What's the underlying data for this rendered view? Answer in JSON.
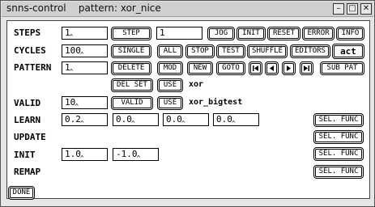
{
  "window": {
    "title": "snns-control    pattern: xor_nice",
    "controls": [
      "–",
      "□",
      "✕"
    ]
  },
  "rows": {
    "steps": {
      "label": "STEPS",
      "value": "1",
      "step_button": "STEP",
      "step_count": "1",
      "buttons": [
        "JOG",
        "INIT",
        "RESET",
        "ERROR",
        "INFO"
      ]
    },
    "cycles": {
      "label": "CYCLES",
      "value": "100",
      "buttons": [
        "SINGLE",
        "ALL",
        "STOP",
        "TEST",
        "SHUFFLE",
        "EDITORS"
      ],
      "act_label": "act"
    },
    "pattern": {
      "label": "PATTERN",
      "value": "1",
      "buttons": [
        "DELETE",
        "MOD",
        "NEW",
        "GOTO"
      ],
      "nav_icons": [
        "first-icon",
        "prev-icon",
        "next-icon",
        "last-icon"
      ],
      "sub_pat": "SUB PAT"
    },
    "set": {
      "del_set": "DEL SET",
      "use": "USE",
      "set_name": "xor"
    },
    "valid": {
      "label": "VALID",
      "value": "10",
      "valid_button": "VALID",
      "use": "USE",
      "set_name": "xor_bigtest"
    },
    "learn": {
      "label": "LEARN",
      "params": [
        "0.2",
        "0.0",
        "0.0",
        "0.0"
      ],
      "func_button": "SEL. FUNC"
    },
    "update": {
      "label": "UPDATE",
      "func_button": "SEL. FUNC"
    },
    "init": {
      "label": "INIT",
      "params": [
        "1.0",
        "-1.0"
      ],
      "func_button": "SEL. FUNC"
    },
    "remap": {
      "label": "REMAP",
      "func_button": "SEL. FUNC"
    }
  },
  "footer": {
    "done": "DONE"
  }
}
